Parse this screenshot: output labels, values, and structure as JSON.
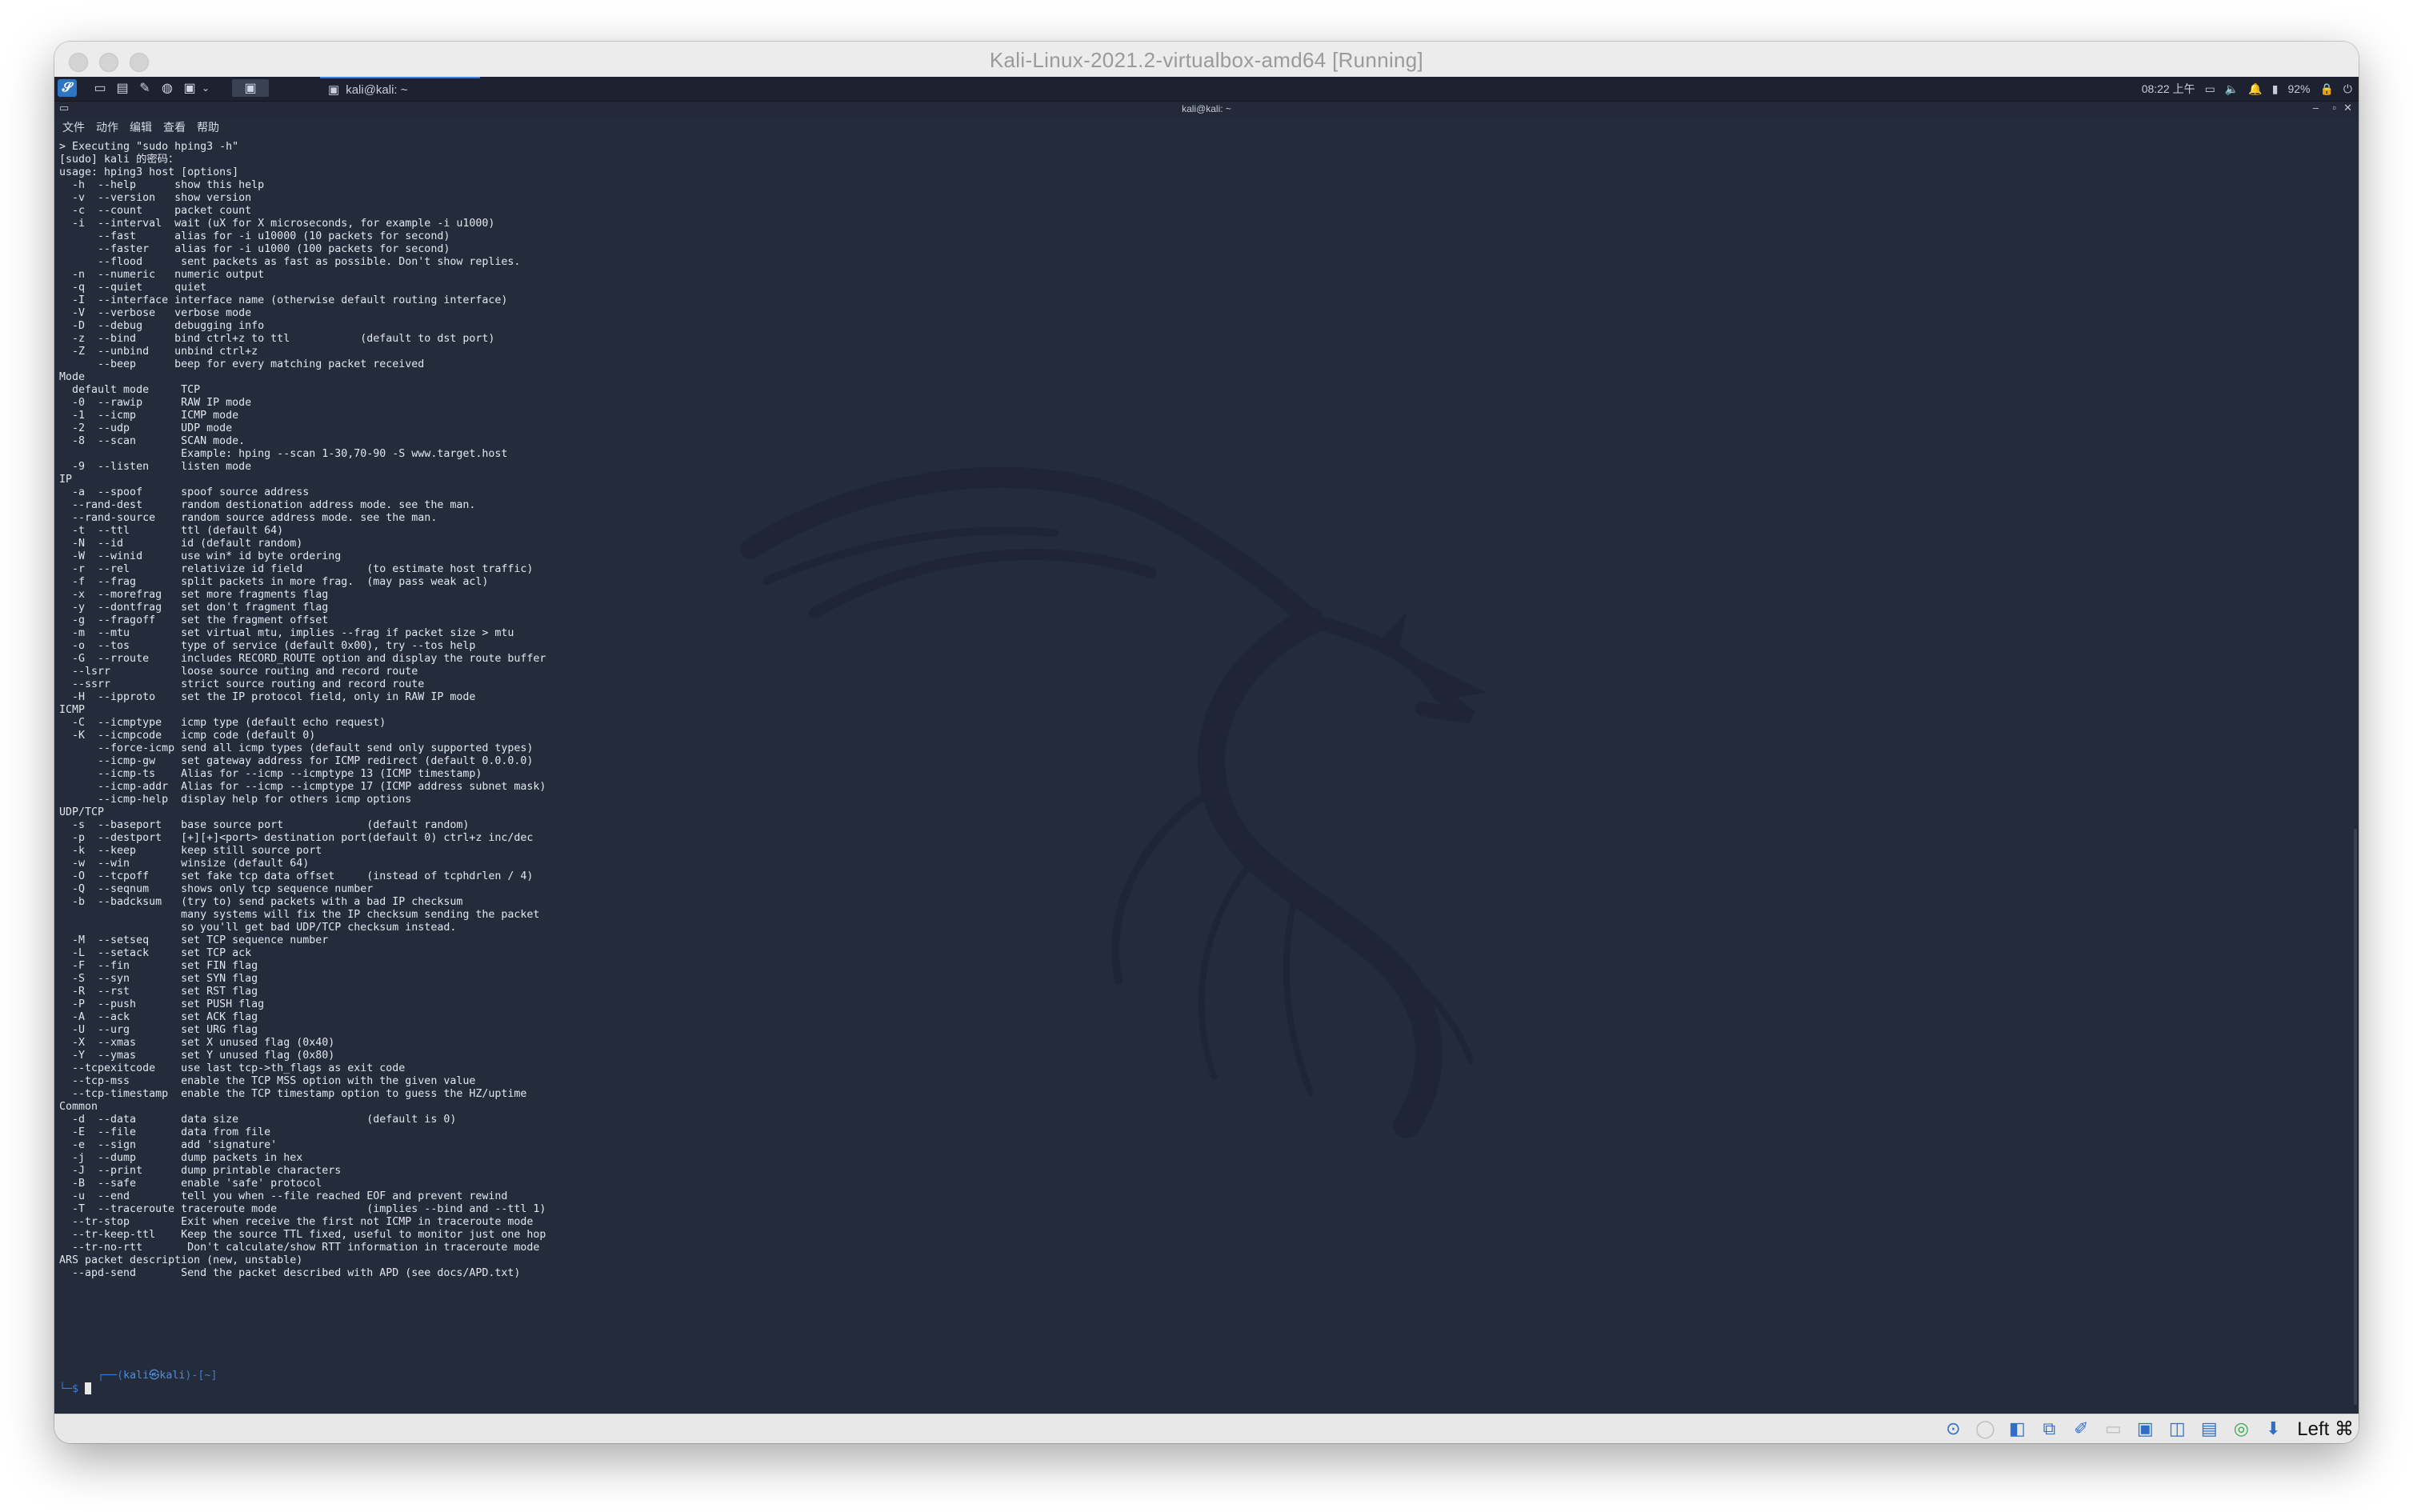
{
  "window": {
    "title": "Kali-Linux-2021.2-virtualbox-amd64 [Running]"
  },
  "panel": {
    "task_label": "kali@kali: ~",
    "clock": "08:22 上午",
    "battery": "92%"
  },
  "terminal_window": {
    "title": "kali@kali: ~",
    "controls": [
      "–",
      "▫",
      "✕"
    ]
  },
  "menu": [
    "文件",
    "动作",
    "编辑",
    "查看",
    "帮助"
  ],
  "terminal": {
    "lines": [
      "> Executing \"sudo hping3 -h\"",
      "[sudo] kali 的密码：",
      "usage: hping3 host [options]",
      "  -h  --help      show this help",
      "  -v  --version   show version",
      "  -c  --count     packet count",
      "  -i  --interval  wait (uX for X microseconds, for example -i u1000)",
      "      --fast      alias for -i u10000 (10 packets for second)",
      "      --faster    alias for -i u1000 (100 packets for second)",
      "      --flood      sent packets as fast as possible. Don't show replies.",
      "  -n  --numeric   numeric output",
      "  -q  --quiet     quiet",
      "  -I  --interface interface name (otherwise default routing interface)",
      "  -V  --verbose   verbose mode",
      "  -D  --debug     debugging info",
      "  -z  --bind      bind ctrl+z to ttl           (default to dst port)",
      "  -Z  --unbind    unbind ctrl+z",
      "      --beep      beep for every matching packet received",
      "Mode",
      "  default mode     TCP",
      "  -0  --rawip      RAW IP mode",
      "  -1  --icmp       ICMP mode",
      "  -2  --udp        UDP mode",
      "  -8  --scan       SCAN mode.",
      "                   Example: hping --scan 1-30,70-90 -S www.target.host",
      "  -9  --listen     listen mode",
      "IP",
      "  -a  --spoof      spoof source address",
      "  --rand-dest      random destionation address mode. see the man.",
      "  --rand-source    random source address mode. see the man.",
      "  -t  --ttl        ttl (default 64)",
      "  -N  --id         id (default random)",
      "  -W  --winid      use win* id byte ordering",
      "  -r  --rel        relativize id field          (to estimate host traffic)",
      "  -f  --frag       split packets in more frag.  (may pass weak acl)",
      "  -x  --morefrag   set more fragments flag",
      "  -y  --dontfrag   set don't fragment flag",
      "  -g  --fragoff    set the fragment offset",
      "  -m  --mtu        set virtual mtu, implies --frag if packet size > mtu",
      "  -o  --tos        type of service (default 0x00), try --tos help",
      "  -G  --rroute     includes RECORD_ROUTE option and display the route buffer",
      "  --lsrr           loose source routing and record route",
      "  --ssrr           strict source routing and record route",
      "  -H  --ipproto    set the IP protocol field, only in RAW IP mode",
      "ICMP",
      "  -C  --icmptype   icmp type (default echo request)",
      "  -K  --icmpcode   icmp code (default 0)",
      "      --force-icmp send all icmp types (default send only supported types)",
      "      --icmp-gw    set gateway address for ICMP redirect (default 0.0.0.0)",
      "      --icmp-ts    Alias for --icmp --icmptype 13 (ICMP timestamp)",
      "      --icmp-addr  Alias for --icmp --icmptype 17 (ICMP address subnet mask)",
      "      --icmp-help  display help for others icmp options",
      "UDP/TCP",
      "  -s  --baseport   base source port             (default random)",
      "  -p  --destport   [+][+]<port> destination port(default 0) ctrl+z inc/dec",
      "  -k  --keep       keep still source port",
      "  -w  --win        winsize (default 64)",
      "  -O  --tcpoff     set fake tcp data offset     (instead of tcphdrlen / 4)",
      "  -Q  --seqnum     shows only tcp sequence number",
      "  -b  --badcksum   (try to) send packets with a bad IP checksum",
      "                   many systems will fix the IP checksum sending the packet",
      "                   so you'll get bad UDP/TCP checksum instead.",
      "  -M  --setseq     set TCP sequence number",
      "  -L  --setack     set TCP ack",
      "  -F  --fin        set FIN flag",
      "  -S  --syn        set SYN flag",
      "  -R  --rst        set RST flag",
      "  -P  --push       set PUSH flag",
      "  -A  --ack        set ACK flag",
      "  -U  --urg        set URG flag",
      "  -X  --xmas       set X unused flag (0x40)",
      "  -Y  --ymas       set Y unused flag (0x80)",
      "  --tcpexitcode    use last tcp->th_flags as exit code",
      "  --tcp-mss        enable the TCP MSS option with the given value",
      "  --tcp-timestamp  enable the TCP timestamp option to guess the HZ/uptime",
      "Common",
      "  -d  --data       data size                    (default is 0)",
      "  -E  --file       data from file",
      "  -e  --sign       add 'signature'",
      "  -j  --dump       dump packets in hex",
      "  -J  --print      dump printable characters",
      "  -B  --safe       enable 'safe' protocol",
      "  -u  --end        tell you when --file reached EOF and prevent rewind",
      "  -T  --traceroute traceroute mode              (implies --bind and --ttl 1)",
      "  --tr-stop        Exit when receive the first not ICMP in traceroute mode",
      "  --tr-keep-ttl    Keep the source TTL fixed, useful to monitor just one hop",
      "  --tr-no-rtt       Don't calculate/show RTT information in traceroute mode",
      "ARS packet description (new, unstable)",
      "  --apd-send       Send the packet described with APD (see docs/APD.txt)"
    ],
    "prompt_open": "┌──(",
    "prompt_user": "kali㉿kali",
    "prompt_close": ")-[~]",
    "prompt_symbol": "└─$ "
  },
  "statusbar": {
    "host_key": "Left ⌘"
  },
  "colors": {
    "desktop": "#242b3b",
    "panel": "#1d2130",
    "prompt": "#3a7fd5"
  }
}
